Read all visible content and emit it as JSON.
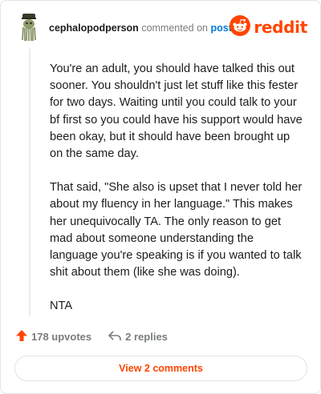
{
  "comment": {
    "username": "cephalopodperson",
    "action_text": "commented on",
    "post_link": "post",
    "paragraphs": [
      "You're an adult, you should have talked this out sooner. You shouldn't just let stuff like this fester for two days. Waiting until you could talk to your bf first so you could have his support would have been okay, but it should have been brought up on the same day.",
      "That said, \"She also is upset that I never told her about my fluency in her language.\" This makes her unequivocally TA. The only reason to get mad about someone understanding the language you're speaking is if you wanted to talk shit about them (like she was doing).",
      "NTA"
    ]
  },
  "brand": {
    "word": "reddit",
    "accent_color": "#ff4500"
  },
  "footer": {
    "upvotes": "178 upvotes",
    "replies": "2 replies",
    "view_comments": "View 2 comments"
  },
  "icons": {
    "avatar": "avatar-icon",
    "brand": "reddit-logo-icon",
    "upvote": "upvote-arrow-icon",
    "reply": "reply-arrow-icon"
  },
  "colors": {
    "link_blue": "#0079d3",
    "upvote_orange": "#ff4500",
    "muted_gray": "#787c7e"
  }
}
